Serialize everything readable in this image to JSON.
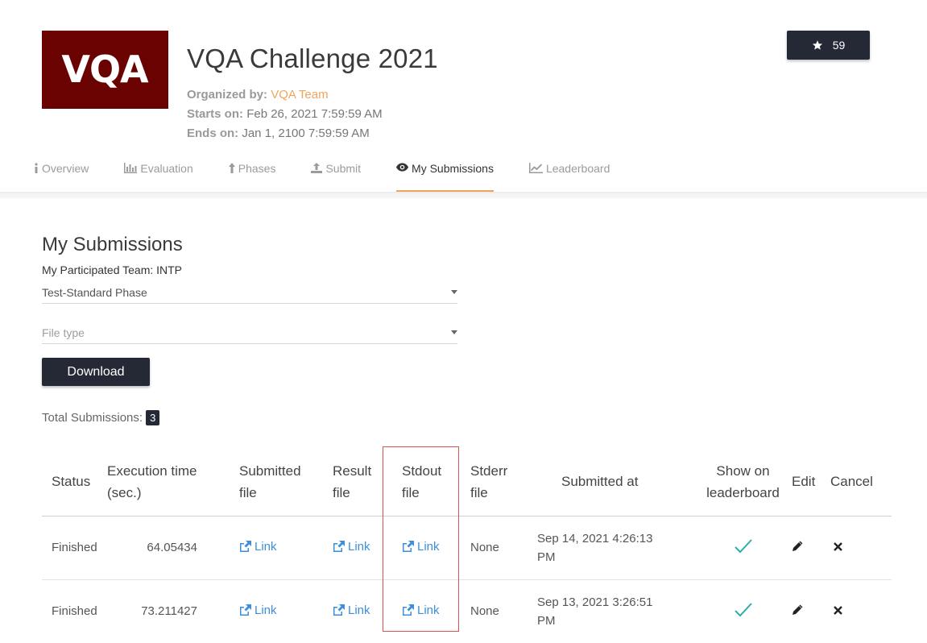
{
  "challenge": {
    "logo_text": "VQA",
    "title": "VQA Challenge 2021",
    "organized_label": "Organized by:",
    "organizer": "VQA Team",
    "starts_label": "Starts on:",
    "starts": "Feb 26, 2021 7:59:59 AM",
    "ends_label": "Ends on:",
    "ends": "Jan 1, 2100 7:59:59 AM",
    "star_count": "59",
    "star_icon": "star-icon"
  },
  "tabs": [
    {
      "label": "Overview",
      "icon": "info-icon"
    },
    {
      "label": "Evaluation",
      "icon": "bar-chart-icon"
    },
    {
      "label": "Phases",
      "icon": "upload-arrow-icon"
    },
    {
      "label": "Submit",
      "icon": "upload-icon"
    },
    {
      "label": "My Submissions",
      "icon": "eye-icon",
      "active": true
    },
    {
      "label": "Leaderboard",
      "icon": "line-chart-icon"
    }
  ],
  "submissions": {
    "heading": "My Submissions",
    "team_line": "My Participated Team: INTP",
    "phase_select": "Test-Standard Phase",
    "file_type_placeholder": "File type",
    "download_label": "Download",
    "total_label": "Total Submissions:",
    "total_count": "3",
    "columns": {
      "status": "Status",
      "exec_1": "Execution time",
      "exec_2": "(sec.)",
      "submitted_1": "Submitted",
      "submitted_2": "file",
      "result_1": "Result",
      "result_2": "file",
      "stdout_1": "Stdout",
      "stdout_2": "file",
      "stderr_1": "Stderr",
      "stderr_2": "file",
      "submitted_at": "Submitted at",
      "show_1": "Show on",
      "show_2": "leaderboard",
      "edit": "Edit",
      "cancel": "Cancel"
    },
    "link_label": "Link",
    "rows": [
      {
        "status": "Finished",
        "exec_time": "64.05434",
        "stderr": "None",
        "date_1": "Sep 14, 2021 4:26:13",
        "date_2": "PM"
      },
      {
        "status": "Finished",
        "exec_time": "73.211427",
        "stderr": "None",
        "date_1": "Sep 13, 2021 3:26:51",
        "date_2": "PM"
      }
    ]
  },
  "colors": {
    "accent_orange": "#f0a35e",
    "dark_button": "#252936",
    "logo_bg": "#6b0202",
    "status_green": "#3a7a2d",
    "link_blue": "#3c8fdc",
    "check_teal": "#2ab0a8",
    "highlight_red": "#d9534f"
  }
}
